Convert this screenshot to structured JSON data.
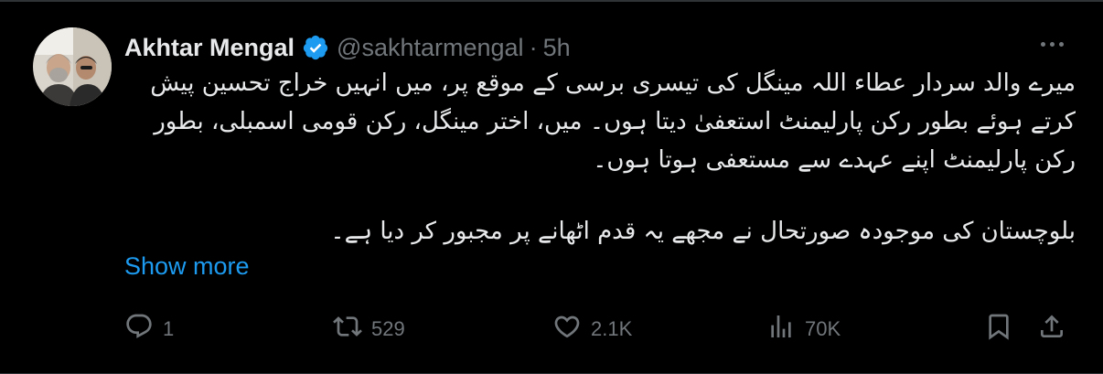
{
  "author": {
    "name": "Akhtar Mengal",
    "handle": "@sakhtarmengal",
    "separator": "·",
    "time": "5h",
    "verified": true
  },
  "tweet": {
    "paragraphs": [
      "میرے والد سردار عطاء اللہ مینگل کی تیسری برسی کے موقع پر، میں انہیں خراج تحسین پیش کرتے ہوئے بطور رکن پارلیمنٹ استعفیٰ دیتا ہوں۔ میں، اختر مینگل، رکن قومی اسمبلی، بطور رکن پارلیمنٹ اپنے عہدے سے مستعفی ہوتا ہوں۔",
      "بلوچستان کی موجودہ صورتحال نے مجھے یہ قدم اٹھانے پر مجبور کر دیا ہے۔"
    ],
    "show_more_label": "Show more"
  },
  "actions": {
    "reply_count": "1",
    "repost_count": "529",
    "like_count": "2.1K",
    "views_count": "70K"
  },
  "icons": {
    "verified": "verified-badge-icon",
    "more": "more-options-icon",
    "reply": "reply-icon",
    "repost": "repost-icon",
    "like": "heart-icon",
    "views": "analytics-icon",
    "bookmark": "bookmark-icon",
    "share": "share-icon"
  },
  "colors": {
    "background": "#000000",
    "text": "#e7e9ea",
    "secondary": "#71767b",
    "link": "#1d9bf0",
    "verified": "#1d9bf0"
  }
}
